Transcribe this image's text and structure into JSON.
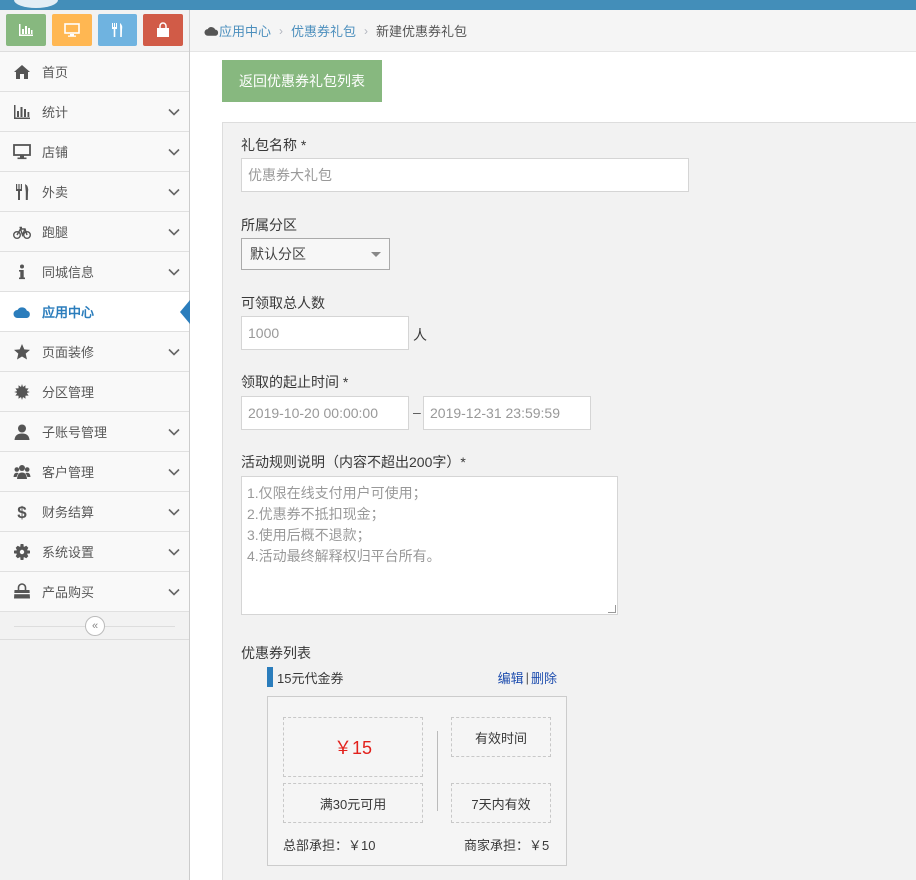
{
  "colors": {
    "shortcut_stats": "#87b87f",
    "shortcut_monitor": "#ffb752",
    "shortcut_food": "#6fb3e0",
    "shortcut_bag": "#d15b47",
    "brand": "#438eb9",
    "active_nav": "#2b7dbc",
    "back_button": "#87b87f",
    "price": "#e2211c"
  },
  "shortcuts": [
    {
      "icon": "bar-chart-icon"
    },
    {
      "icon": "monitor-icon"
    },
    {
      "icon": "cutlery-icon"
    },
    {
      "icon": "shopping-bag-icon"
    }
  ],
  "sidebar": {
    "items": [
      {
        "label": "首页",
        "icon": "home-icon",
        "expandable": false
      },
      {
        "label": "统计",
        "icon": "bar-chart-icon",
        "expandable": true
      },
      {
        "label": "店铺",
        "icon": "desktop-icon",
        "expandable": true
      },
      {
        "label": "外卖",
        "icon": "cutlery-icon",
        "expandable": true
      },
      {
        "label": "跑腿",
        "icon": "bicycle-icon",
        "expandable": true
      },
      {
        "label": "同城信息",
        "icon": "info-icon",
        "expandable": true
      },
      {
        "label": "应用中心",
        "icon": "cloud-icon",
        "expandable": false,
        "active": true
      },
      {
        "label": "页面装修",
        "icon": "star-icon",
        "expandable": true
      },
      {
        "label": "分区管理",
        "icon": "gear-badge-icon",
        "expandable": false
      },
      {
        "label": "子账号管理",
        "icon": "user-icon",
        "expandable": true
      },
      {
        "label": "客户管理",
        "icon": "users-icon",
        "expandable": true
      },
      {
        "label": "财务结算",
        "icon": "dollar-icon",
        "expandable": true
      },
      {
        "label": "系统设置",
        "icon": "cog-icon",
        "expandable": true
      },
      {
        "label": "产品购买",
        "icon": "shopping-bag-icon",
        "expandable": true
      }
    ],
    "collapse_glyph": "«"
  },
  "breadcrumb": {
    "items": [
      "应用中心",
      "优惠券礼包"
    ],
    "current": "新建优惠券礼包",
    "separator": "›"
  },
  "back_button": "返回优惠券礼包列表",
  "form": {
    "name_label": "礼包名称 *",
    "name_placeholder": "优惠券大礼包",
    "zone_label": "所属分区",
    "zone_value": "默认分区",
    "total_label": "可领取总人数",
    "total_value": "1000",
    "total_unit": "人",
    "time_label": "领取的起止时间 *",
    "start_time": "2019-10-20 00:00:00",
    "time_sep": "–",
    "end_time": "2019-12-31 23:59:59",
    "rules_label": "活动规则说明（内容不超出200字）*",
    "rules_lines": [
      "1.仅限在线支付用户可使用；",
      "2.优惠券不抵扣现金；",
      "3.使用后概不退款；",
      "4.活动最终解释权归平台所有。"
    ],
    "coupon_list_label": "优惠券列表"
  },
  "coupon": {
    "name": "15元代金券",
    "edit": "编辑",
    "pipe": "|",
    "delete": "删除",
    "price": "￥15",
    "condition": "满30元可用",
    "valid_title": "有效时间",
    "valid_value": "7天内有效",
    "hq_share": "总部承担：￥10",
    "merchant_share": "商家承担：￥5"
  }
}
